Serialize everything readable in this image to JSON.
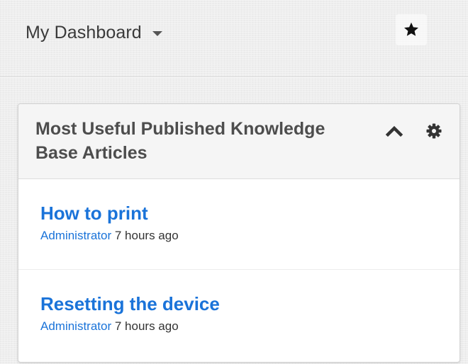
{
  "header": {
    "dashboard_title": "My Dashboard",
    "dropdown_icon": "caret-down-icon",
    "favorite_icon": "star-icon"
  },
  "widget": {
    "title": "Most Useful Published Knowledge Base Articles",
    "collapse_icon": "chevron-up-icon",
    "settings_icon": "gear-icon",
    "articles": [
      {
        "title": "How to print",
        "author": "Administrator",
        "time": "7 hours ago"
      },
      {
        "title": "Resetting the device",
        "author": "Administrator",
        "time": "7 hours ago"
      }
    ]
  },
  "colors": {
    "link": "#1a73d9",
    "page_background": "#eeeeee",
    "header_text": "#3a3a3a",
    "widget_header_background": "#f5f5f5"
  }
}
